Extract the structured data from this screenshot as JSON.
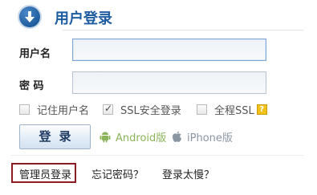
{
  "header": {
    "title": "用户登录",
    "icon": "circle-down-arrow-icon"
  },
  "form": {
    "username_label": "用户名",
    "username_value": "",
    "password_label": "密 码",
    "password_value": ""
  },
  "options": {
    "remember_label": "记住用户名",
    "ssl_label": "SSL安全登录",
    "full_ssl_label": "全程SSL",
    "help_icon_text": "?"
  },
  "login_button": {
    "label": "登录"
  },
  "apps": {
    "android_label": "Android版",
    "iphone_label": "iPhone版",
    "android_color": "#8ab45a",
    "apple_color": "#8b96a3"
  },
  "links": {
    "admin_login": "管理员登录",
    "forgot_password": "忘记密码？",
    "login_slow": "登录太慢？"
  },
  "colors": {
    "title": "#1e5ca1",
    "highlight_box": "#8c1b22"
  }
}
